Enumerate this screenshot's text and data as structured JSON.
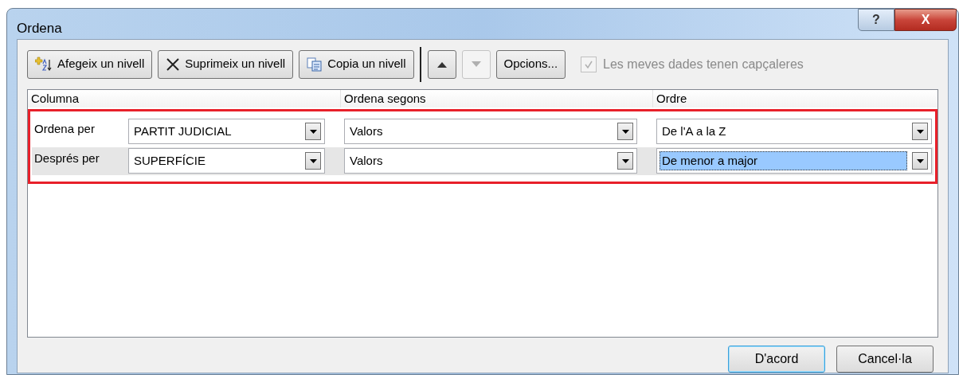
{
  "window": {
    "title": "Ordena",
    "help": "?",
    "close": "X"
  },
  "toolbar": [
    {
      "kind": "add",
      "label": "Afegeix un nivell",
      "disabled": false
    },
    {
      "kind": "delete",
      "label": "Suprimeix un nivell",
      "disabled": false
    },
    {
      "kind": "copy",
      "label": "Copia un nivell",
      "disabled": false
    },
    {
      "kind": "up",
      "disabled": false
    },
    {
      "kind": "down",
      "disabled": true
    },
    {
      "kind": "text",
      "label": "Opcions...",
      "disabled": false
    }
  ],
  "headers_checkbox": {
    "label": "Les meves dades tenen capçaleres",
    "checked": true,
    "disabled": true
  },
  "columns": [
    "Columna",
    "Ordena segons",
    "Ordre"
  ],
  "rows": [
    {
      "label": "Ordena per",
      "column": "PARTIT JUDICIAL",
      "sort_on": "Valors",
      "order": "De l'A a la Z",
      "selected": false
    },
    {
      "label": "Després per",
      "column": "SUPERFÍCIE",
      "sort_on": "Valors",
      "order": "De menor a major",
      "selected": true
    }
  ],
  "buttons": [
    {
      "label": "D'acord",
      "default": true
    },
    {
      "label": "Cancel·la",
      "default": false
    }
  ]
}
